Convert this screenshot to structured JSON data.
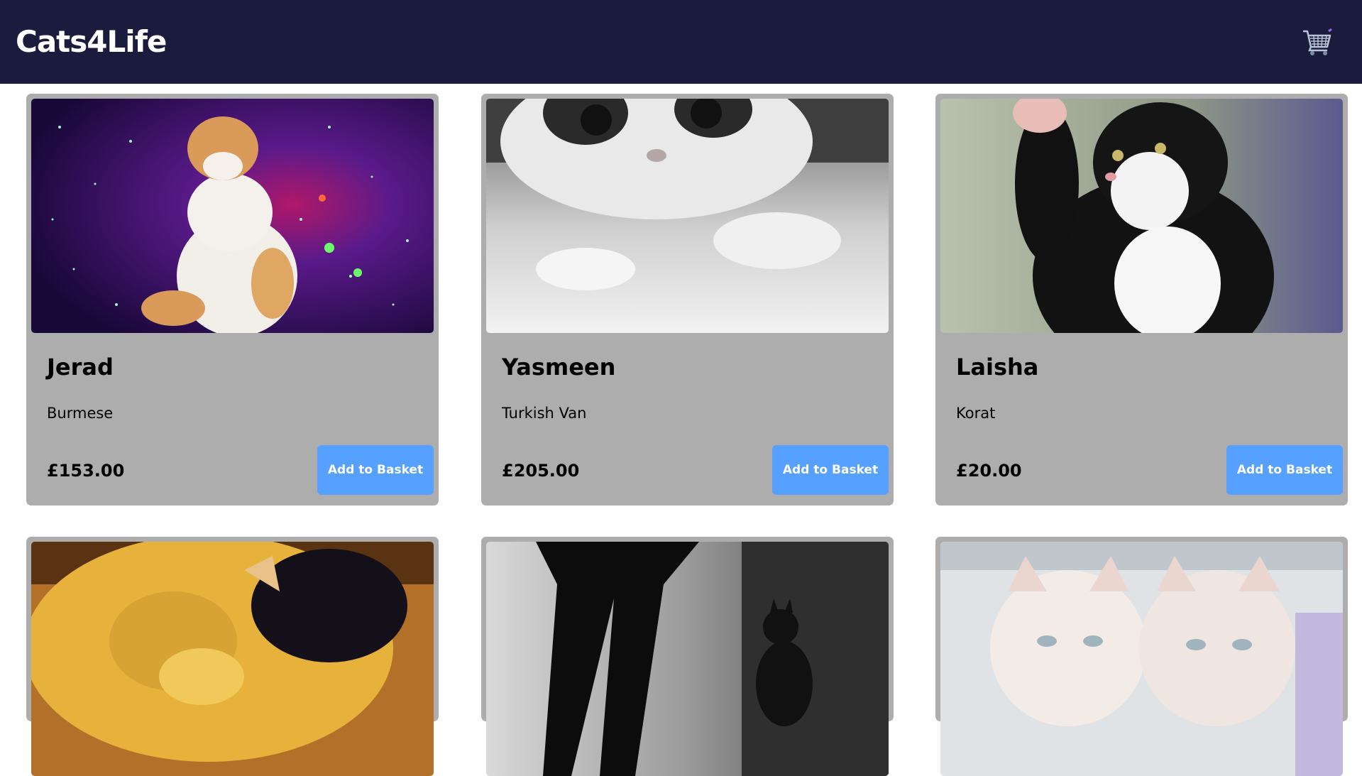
{
  "header": {
    "logo": "Cats4Life",
    "cart_icon": "shopping-cart-icon"
  },
  "products": [
    {
      "name": "Jerad",
      "breed": "Burmese",
      "price": "£153.00",
      "button_label": "Add to Basket"
    },
    {
      "name": "Yasmeen",
      "breed": "Turkish Van",
      "price": "£205.00",
      "button_label": "Add to Basket"
    },
    {
      "name": "Laisha",
      "breed": "Korat",
      "price": "£20.00",
      "button_label": "Add to Basket"
    },
    {
      "name": "",
      "breed": "",
      "price": "",
      "button_label": ""
    },
    {
      "name": "",
      "breed": "",
      "price": "",
      "button_label": ""
    },
    {
      "name": "",
      "breed": "",
      "price": "",
      "button_label": ""
    }
  ],
  "colors": {
    "header_bg": "#1b1b3d",
    "card_bg": "#adadad",
    "button_bg": "#56a0ff"
  }
}
